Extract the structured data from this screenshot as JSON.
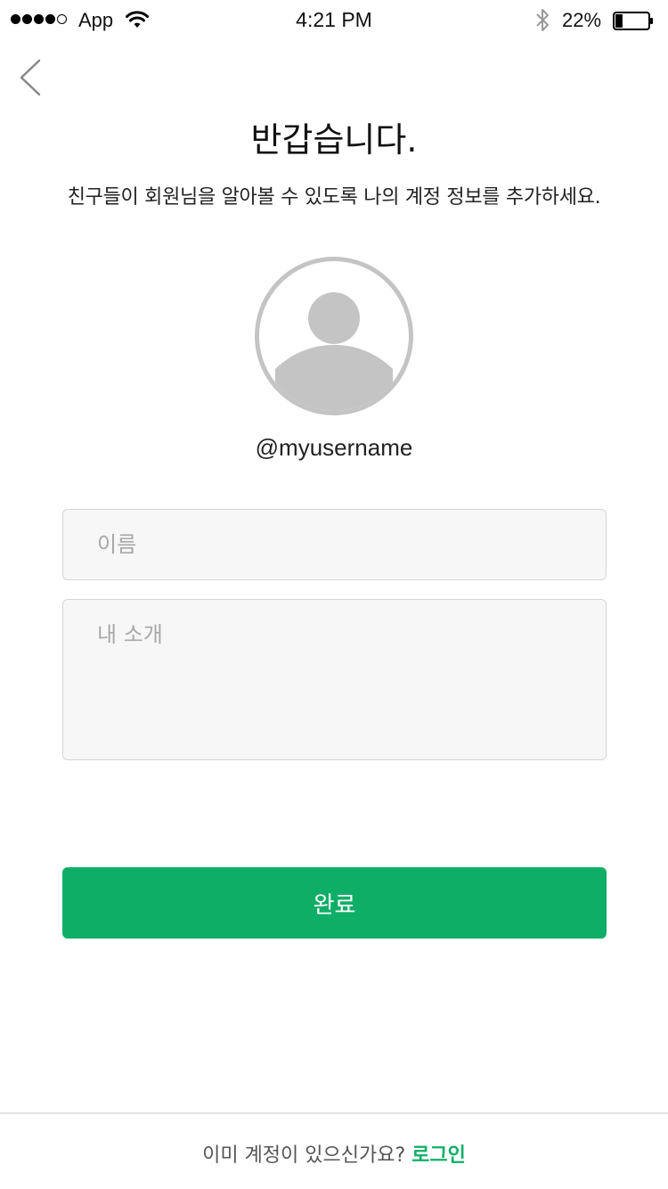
{
  "status_bar": {
    "carrier": "App",
    "time": "4:21 PM",
    "battery_percent": "22%",
    "battery_level": 0.22,
    "signal_bars_filled": 4,
    "signal_bars_total": 5
  },
  "header": {
    "title": "반갑습니다.",
    "subtitle": "친구들이 회원님을 알아볼 수 있도록 나의 계정 정보를 추가하세요."
  },
  "profile": {
    "username": "@myusername"
  },
  "form": {
    "name_placeholder": "이름",
    "name_value": "",
    "bio_placeholder": "내 소개",
    "bio_value": "",
    "submit_label": "완료"
  },
  "footer": {
    "prompt": "이미 계정이 있으신가요?",
    "login_label": "로그인"
  },
  "colors": {
    "accent": "#0fae67",
    "field_bg": "#f7f7f7",
    "avatar_gray": "#c4c4c4"
  }
}
